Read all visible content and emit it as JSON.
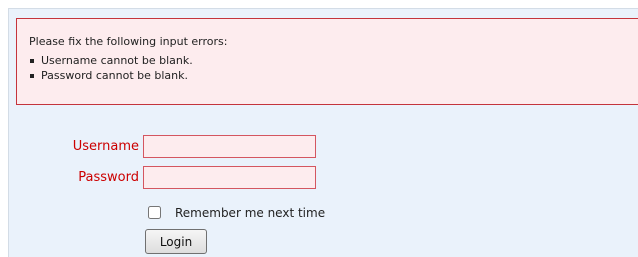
{
  "errors": {
    "heading": "Please fix the following input errors:",
    "items": [
      "Username cannot be blank.",
      "Password cannot be blank."
    ]
  },
  "form": {
    "username_label": "Username",
    "username_value": "",
    "password_label": "Password",
    "password_value": "",
    "remember_label": "Remember me next time",
    "remember_checked": false,
    "login_label": "Login"
  },
  "colors": {
    "error_border": "#c4343c",
    "error_background": "#fdecee",
    "label_error": "#cc0000",
    "page_background": "#eaf2fb"
  }
}
